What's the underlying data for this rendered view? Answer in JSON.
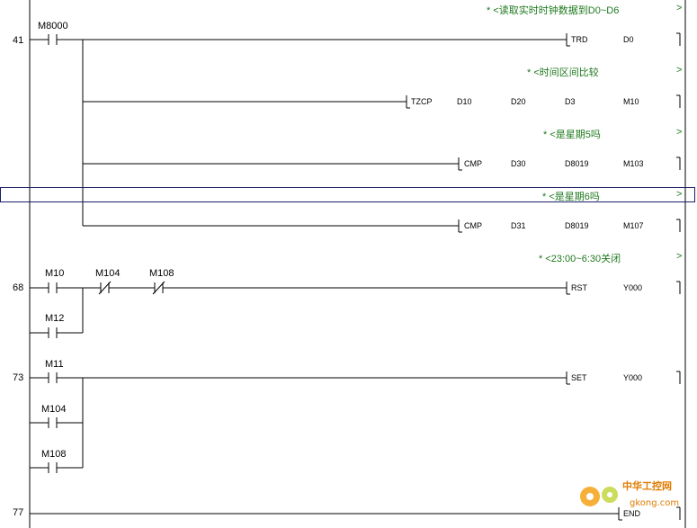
{
  "steps": [
    "41",
    "68",
    "73",
    "77"
  ],
  "comments": [
    "* <读取实时时钟数据到D0~D6",
    "* <时间区间比较",
    "* <是星期5吗",
    "* <是星期6吗",
    "* <23:00~6:30关闭"
  ],
  "comment_end": ">",
  "contacts": {
    "m8000": "M8000",
    "m10": "M10",
    "m104_a": "M104",
    "m108_a": "M108",
    "m12": "M12",
    "m11": "M11",
    "m104_b": "M104",
    "m108_b": "M108"
  },
  "instructions": {
    "trd": [
      "TRD",
      "D0"
    ],
    "tzcp": [
      "TZCP",
      "D10",
      "D20",
      "D3",
      "M10"
    ],
    "cmp1": [
      "CMP",
      "D30",
      "D8019",
      "M103"
    ],
    "cmp2": [
      "CMP",
      "D31",
      "D8019",
      "M107"
    ],
    "rst": [
      "RST",
      "Y000"
    ],
    "set": [
      "SET",
      "Y000"
    ],
    "end": [
      "END"
    ]
  },
  "watermark": {
    "brand": "中华工控网",
    "url": "gkong.com"
  },
  "colors": {
    "comment": "#1f7a1f",
    "selection": "#1a1f6a",
    "line": "#000000"
  }
}
